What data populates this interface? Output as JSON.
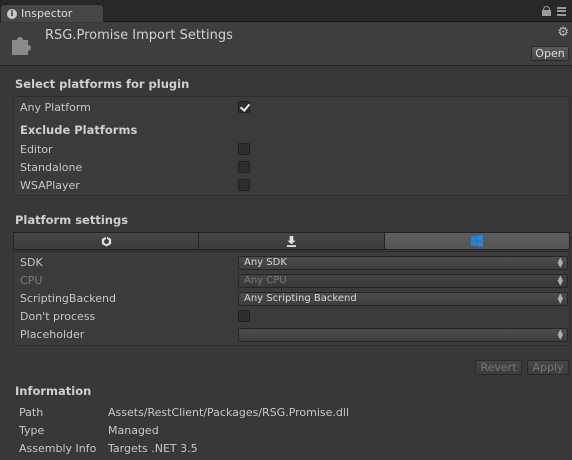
{
  "tab": {
    "label": "Inspector"
  },
  "header": {
    "title": "RSG.Promise Import Settings",
    "open_label": "Open"
  },
  "select_platforms": {
    "title": "Select platforms for plugin",
    "any_platform": {
      "label": "Any Platform",
      "checked": true
    },
    "exclude_title": "Exclude Platforms",
    "exclude": [
      {
        "label": "Editor",
        "checked": false
      },
      {
        "label": "Standalone",
        "checked": false
      },
      {
        "label": "WSAPlayer",
        "checked": false
      }
    ]
  },
  "platform_settings": {
    "title": "Platform settings",
    "tabs": [
      "unity-icon",
      "download-icon",
      "windows-icon"
    ],
    "selected_tab": 2,
    "rows": {
      "sdk": {
        "label": "SDK",
        "value": "Any SDK"
      },
      "cpu": {
        "label": "CPU",
        "value": "Any CPU"
      },
      "scripting": {
        "label": "ScriptingBackend",
        "value": "Any Scripting Backend"
      },
      "dont_process": {
        "label": "Don't process",
        "checked": false
      },
      "placeholder": {
        "label": "Placeholder",
        "value": ""
      }
    }
  },
  "buttons": {
    "revert": "Revert",
    "apply": "Apply"
  },
  "information": {
    "title": "Information",
    "path": {
      "label": "Path",
      "value": "Assets/RestClient/Packages/RSG.Promise.dll"
    },
    "type": {
      "label": "Type",
      "value": "Managed"
    },
    "assembly": {
      "label": "Assembly Info",
      "value": "Targets .NET 3.5"
    }
  },
  "colors": {
    "background": "#383838",
    "selected_tab": "#5a5a5a",
    "windows_blue": "#1e88e5"
  }
}
